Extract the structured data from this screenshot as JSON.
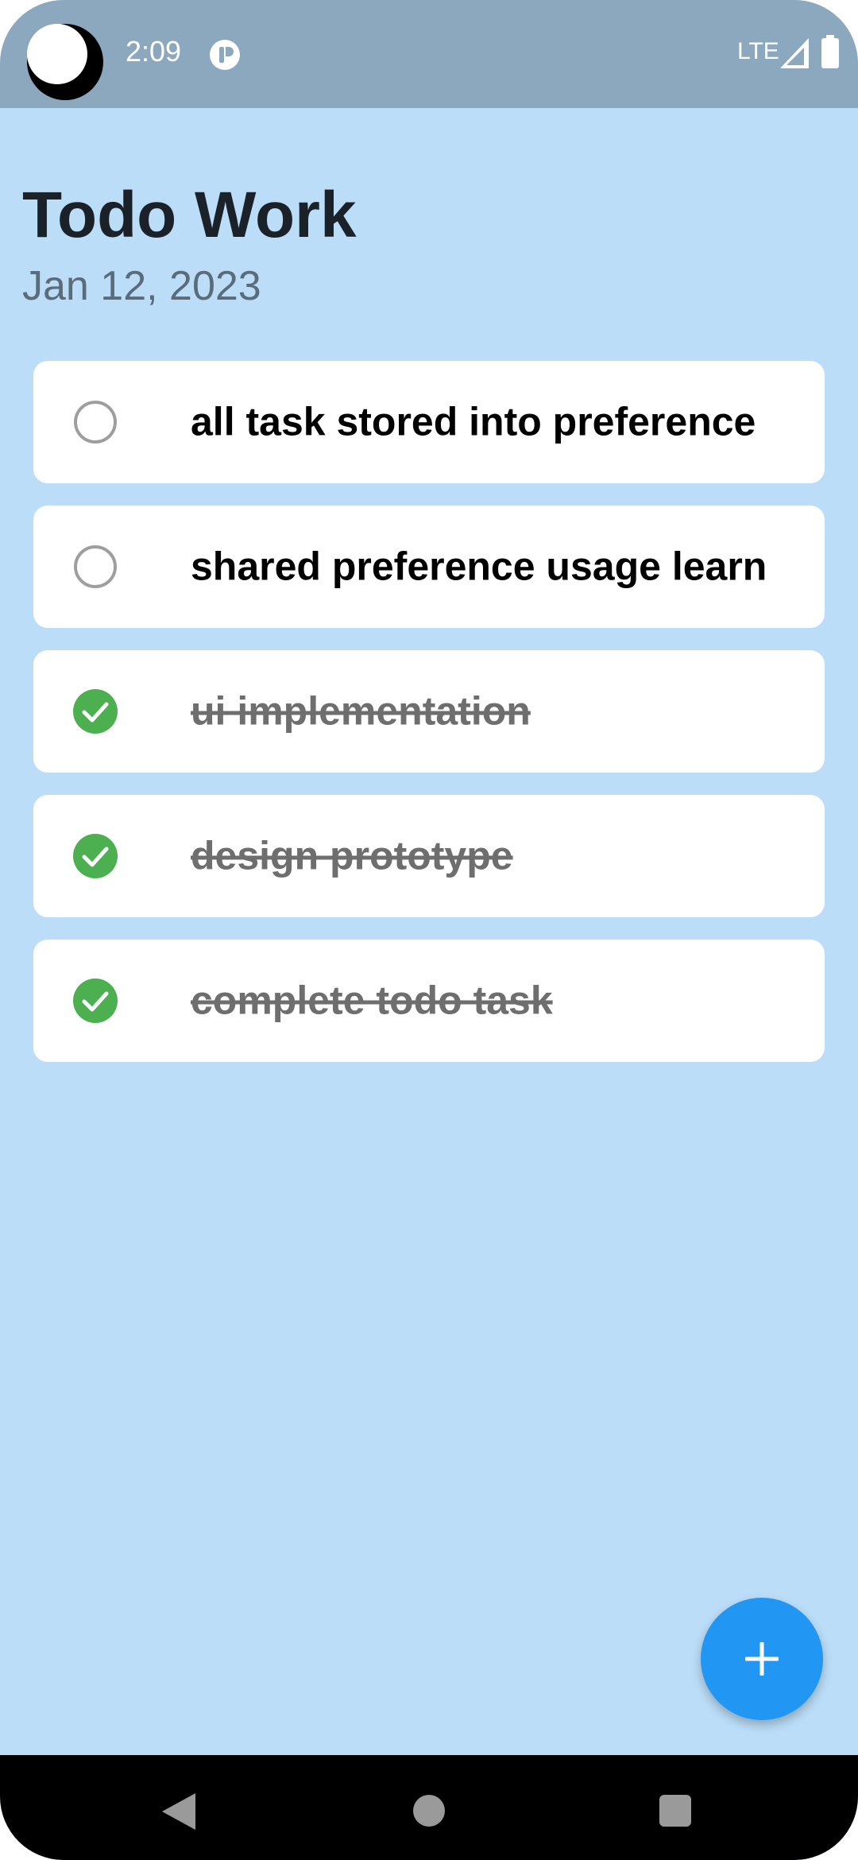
{
  "status_bar": {
    "time": "2:09",
    "network": "LTE",
    "icons": [
      "camera-cutout-icon",
      "notification-app-icon",
      "signal-icon",
      "battery-icon"
    ]
  },
  "header": {
    "title": "Todo Work",
    "date": "Jan 12, 2023"
  },
  "tasks": [
    {
      "text": "all task stored into preference",
      "done": false
    },
    {
      "text": "shared  preference usage learn",
      "done": false
    },
    {
      "text": "ui implementation",
      "done": true
    },
    {
      "text": "design prototype",
      "done": true
    },
    {
      "text": "complete todo task",
      "done": true
    }
  ],
  "fab": {
    "icon": "plus-icon"
  },
  "nav": {
    "icons": [
      "back-icon",
      "home-icon",
      "recents-icon"
    ]
  },
  "colors": {
    "background": "#BBDDF8",
    "status_bar": "#8CA8BF",
    "check_done": "#4CAF50",
    "check_empty": "#9E9E9E",
    "fab": "#2196F3"
  }
}
